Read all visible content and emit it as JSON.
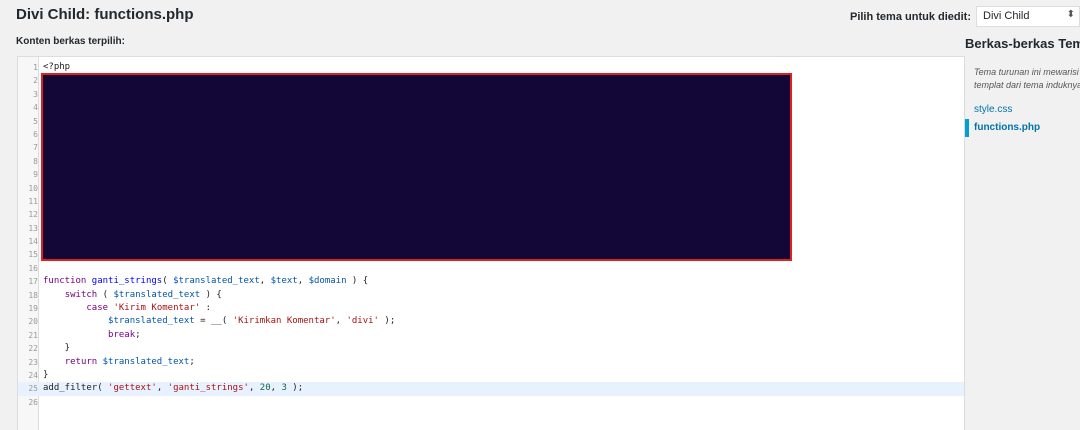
{
  "header": {
    "file_title": "Divi Child: functions.php",
    "theme_select_label": "Pilih tema untuk diedit:",
    "theme_select_value": "Divi Child",
    "theme_select_arrow": "⬍"
  },
  "editor": {
    "content_label": "Konten berkas terpilih:",
    "line_numbers": [
      "1",
      "2",
      "3",
      "4",
      "5",
      "6",
      "7",
      "8",
      "9",
      "10",
      "11",
      "12",
      "13",
      "14",
      "15",
      "16",
      "17",
      "18",
      "19",
      "20",
      "21",
      "22",
      "23",
      "24",
      "25",
      "26"
    ],
    "line1": "<?php",
    "line17": {
      "kw": "function",
      "fn": "ganti_strings",
      "p1": "( ",
      "v1": "$translated_text",
      "p2": ", ",
      "v2": "$text",
      "p3": ", ",
      "v3": "$domain",
      "p4": " ) {"
    },
    "line18": {
      "indent": "    ",
      "kw": "switch",
      "p1": " ( ",
      "v1": "$translated_text",
      "p2": " ) {"
    },
    "line19": {
      "indent": "        ",
      "kw": "case",
      "p1": " ",
      "s1": "'Kirim Komentar'",
      "p2": " :"
    },
    "line20": {
      "indent": "            ",
      "v1": "$translated_text",
      "p1": " = __( ",
      "s1": "'Kirimkan Komentar'",
      "p2": ", ",
      "s2": "'divi'",
      "p3": " );"
    },
    "line21": {
      "indent": "            ",
      "kw": "break",
      "p1": ";"
    },
    "line22": "    }",
    "line23": {
      "indent": "    ",
      "kw": "return",
      "p1": " ",
      "v1": "$translated_text",
      "p2": ";"
    },
    "line24": "}",
    "line25": {
      "fn": "add_filter",
      "p1": "( ",
      "s1": "'gettext'",
      "p2": ", ",
      "s2": "'ganti_strings'",
      "p3": ", ",
      "n1": "20",
      "p4": ", ",
      "n2": "3",
      "p5": " );"
    }
  },
  "sidebar": {
    "title": "Berkas-berkas Tema",
    "description_line1": "Tema turunan ini mewarisi",
    "description_line2": "templat dari tema induknya",
    "files": [
      {
        "label": "style.css",
        "current": false
      },
      {
        "label": "functions.php",
        "current": true
      }
    ]
  },
  "colors": {
    "redaction_fill": "#120736",
    "redaction_border": "#e02020",
    "link": "#0073aa",
    "current_indicator": "#00a0d2"
  }
}
